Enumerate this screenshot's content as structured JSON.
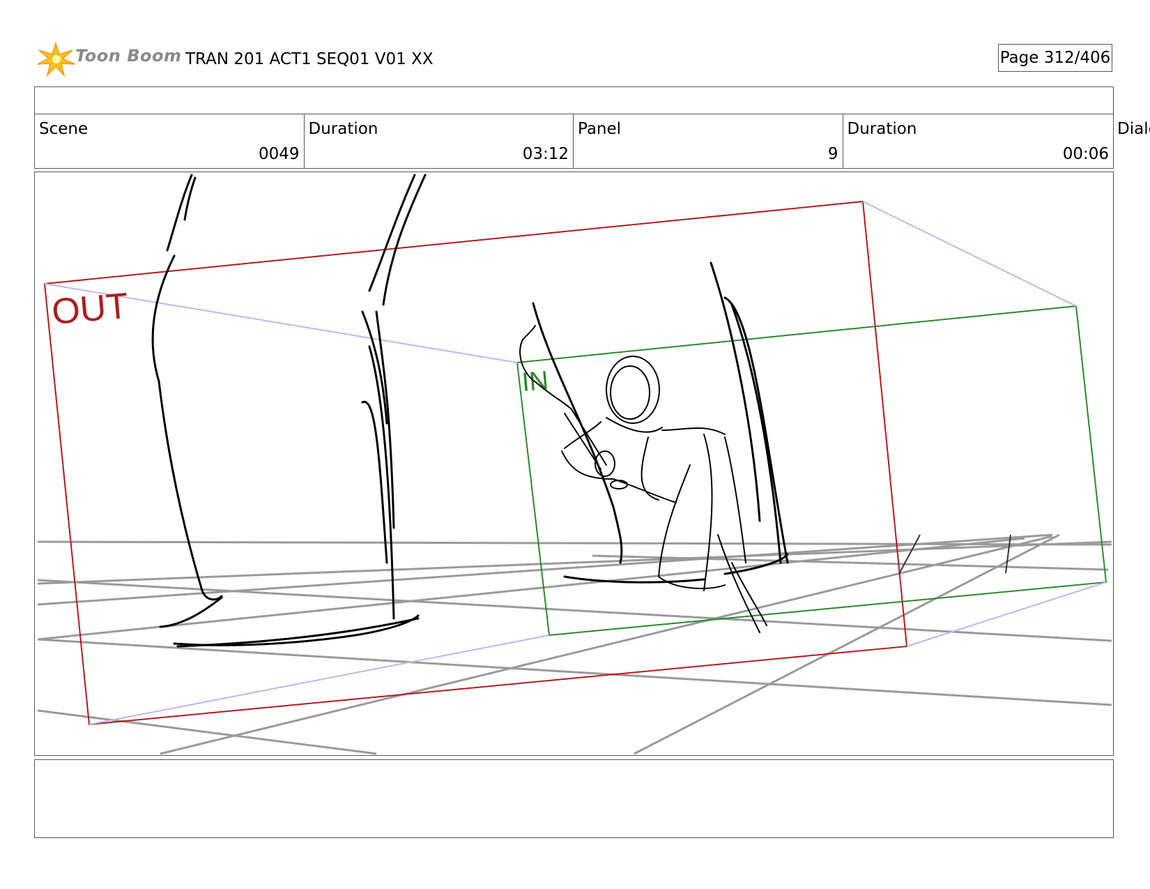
{
  "header": {
    "logo_text": "Toon Boom",
    "document_title": "TRAN 201 ACT1 SEQ01 V01 XX",
    "page_indicator": "Page 312/406"
  },
  "info": {
    "scene_label": "Scene",
    "scene_value": "0049",
    "scene_duration_label": "Duration",
    "scene_duration_value": "03:12",
    "panel_label": "Panel",
    "panel_value": "9",
    "panel_duration_label": "Duration",
    "panel_duration_value": "00:06",
    "dialog_label": "Dialo"
  },
  "panel": {
    "out_label": "OUT",
    "in_label": "IN",
    "out_color": "#b01c1c",
    "in_color": "#2a8a2a",
    "guide_color": "#b9b9f0"
  },
  "notes": {}
}
